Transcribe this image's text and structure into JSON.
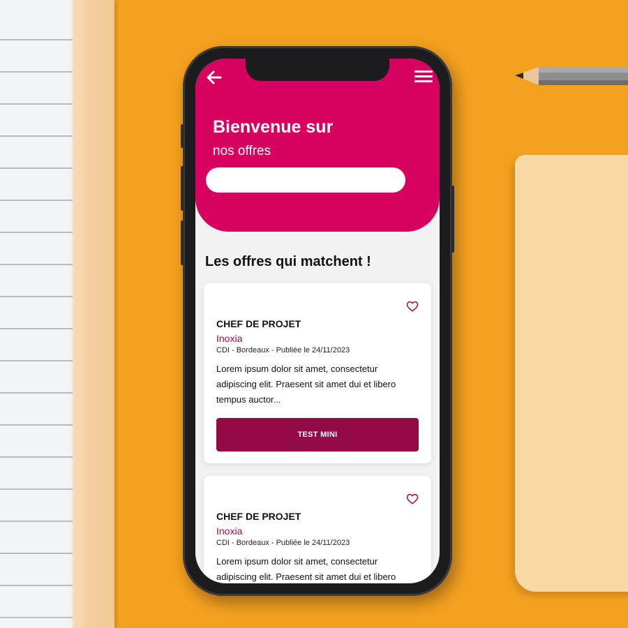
{
  "colors": {
    "brand_pink": "#d7025f",
    "button_maroon": "#940a47",
    "company_text": "#a8064f",
    "background_orange": "#f4a11f"
  },
  "header": {
    "back_icon": "arrow-left-icon",
    "menu_icon": "hamburger-menu-icon",
    "title": "Bienvenue sur",
    "subtitle": "nos offres"
  },
  "search": {
    "value": "",
    "placeholder": ""
  },
  "section": {
    "title": "Les offres qui matchent !"
  },
  "offers": [
    {
      "favorite_icon": "heart-outline-icon",
      "title": "CHEF DE PROJET",
      "company": "Inoxia",
      "meta": "CDI - Bordeaux - Publiée le 24/11/2023",
      "description": "Lorem ipsum dolor sit amet, consectetur adipiscing elit. Praesent sit amet dui et libero tempus auctor...",
      "button_label": "TEST MINI"
    },
    {
      "favorite_icon": "heart-outline-icon",
      "title": "CHEF DE PROJET",
      "company": "Inoxia",
      "meta": "CDI - Bordeaux - Publiée le 24/11/2023",
      "description": "Lorem ipsum dolor sit amet, consectetur adipiscing elit. Praesent sit amet dui et libero"
    }
  ]
}
